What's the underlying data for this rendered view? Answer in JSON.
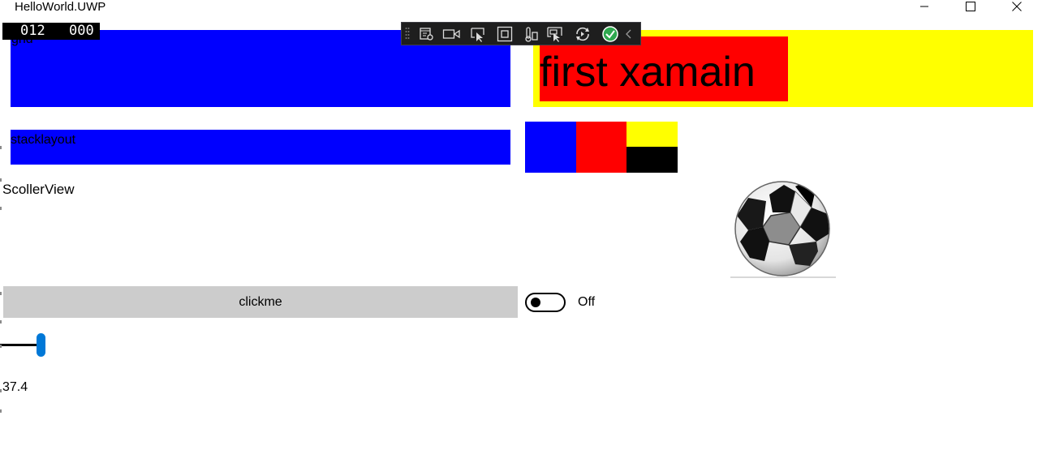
{
  "window": {
    "title": "HelloWorld.UWP"
  },
  "frame_counter": {
    "left": "012",
    "right": "000"
  },
  "debug_toolbar": {
    "icons": [
      "live-visual-tree-icon",
      "record-icon",
      "select-element-icon",
      "display-layout-adorners-icon",
      "track-focus-icon",
      "preview-selection-icon",
      "hot-reload-icon",
      "status-ok-icon",
      "collapse-chevron-icon"
    ]
  },
  "content": {
    "grid_label": "grid",
    "first_label": "first xamain",
    "stack_label": "stacklayout",
    "scroller_label": "ScollerView",
    "button_label": "clickme",
    "toggle_label": "Off",
    "toggle_on": false,
    "slider_value_text": "37.4"
  },
  "colors": {
    "blue": "#0000ff",
    "red": "#ff0000",
    "yellow": "#ffff00",
    "black": "#000000",
    "button_gray": "#cccccc",
    "slider_accent": "#0078d7"
  }
}
